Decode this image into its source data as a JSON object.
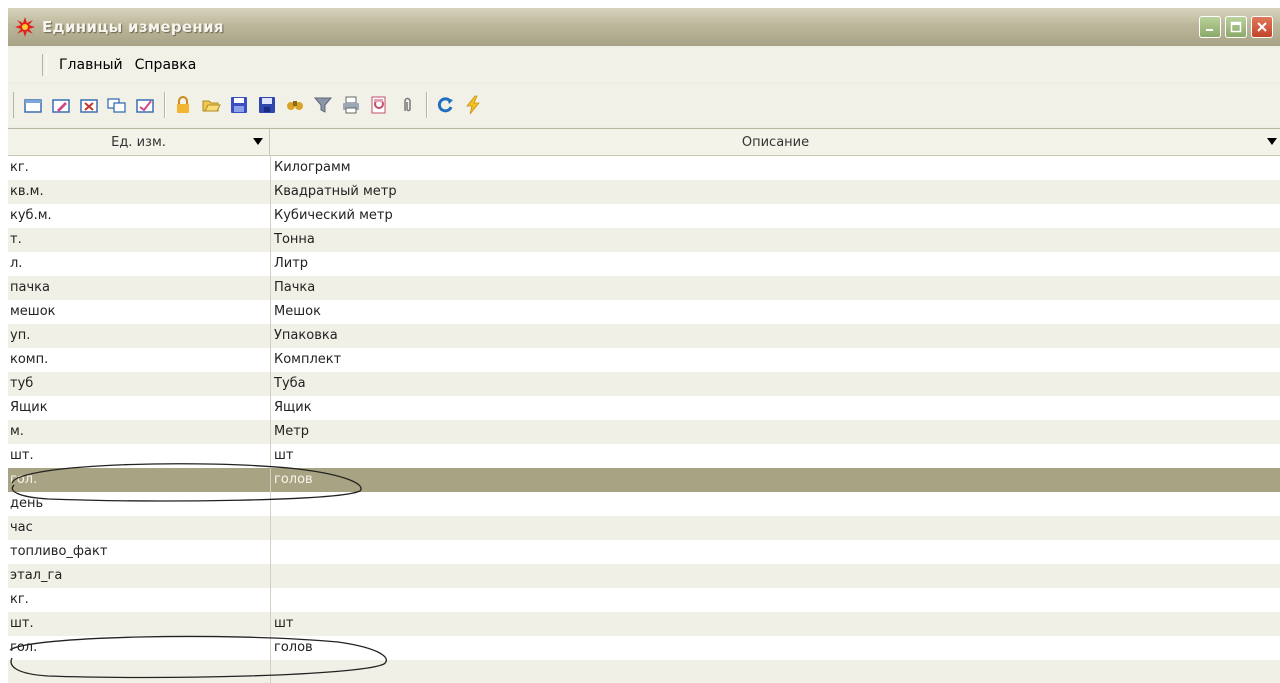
{
  "window": {
    "title": "Единицы измерения",
    "icon": "red-star-icon"
  },
  "menu": {
    "items": [
      "Главный",
      "Справка"
    ]
  },
  "toolbar": {
    "buttons": [
      "new-icon",
      "edit-icon",
      "delete-icon",
      "copy-icon",
      "mark-icon",
      "lock-icon",
      "open-folder-icon",
      "save-icon",
      "save-all-icon",
      "find-icon",
      "filter-icon",
      "print-icon",
      "preview-icon",
      "attach-icon",
      "refresh-icon",
      "execute-icon"
    ]
  },
  "grid": {
    "columns": [
      "Ед. изм.",
      "Описание"
    ],
    "rows": [
      [
        "кг.",
        "Килограмм"
      ],
      [
        "кв.м.",
        "Квадратный метр"
      ],
      [
        "куб.м.",
        "Кубический метр"
      ],
      [
        "т.",
        "Тонна"
      ],
      [
        "л.",
        "Литр"
      ],
      [
        "пачка",
        "Пачка"
      ],
      [
        "мешок",
        "Мешок"
      ],
      [
        "уп.",
        "Упаковка"
      ],
      [
        "комп.",
        "Комплект"
      ],
      [
        "туб",
        "Туба"
      ],
      [
        "Ящик",
        "Ящик"
      ],
      [
        "м.",
        "Метр"
      ],
      [
        "шт.",
        "шт"
      ],
      [
        "гол.",
        "голов"
      ],
      [
        "день",
        ""
      ],
      [
        "час",
        ""
      ],
      [
        "топливо_факт",
        ""
      ],
      [
        "этал_га",
        ""
      ],
      [
        "кг.",
        ""
      ],
      [
        "шт.",
        "шт"
      ],
      [
        "гол.",
        "голов"
      ]
    ],
    "selected_row": 13
  },
  "colors": {
    "title_bar": "#bcb79c",
    "selected_row": "#a8a383",
    "alt_row": "#f1f0e6",
    "annotation_oval": "#222222"
  }
}
